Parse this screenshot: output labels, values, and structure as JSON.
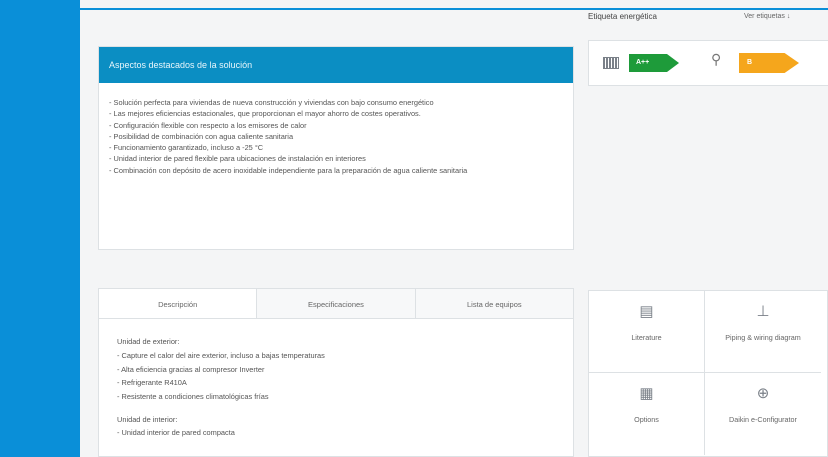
{
  "energy_label": {
    "title": "Etiqueta energética",
    "link": "Ver etiquetas",
    "link_icon": "↓",
    "heating_icon": "radiator-icon",
    "heating_class": "A++",
    "water_icon": "⚲",
    "water_class": "B",
    "colors": {
      "green": "#1e9b3a",
      "orange": "#f5a61c"
    }
  },
  "highlights": {
    "title": "Aspectos destacados de la solución",
    "items": [
      "- Solución perfecta para viviendas de nueva construcción y viviendas con bajo consumo energético",
      "- Las mejores eficiencias estacionales, que proporcionan el mayor ahorro de costes operativos.",
      "- Configuración flexible con respecto a los emisores de calor",
      "- Posibilidad de combinación con agua caliente sanitaria",
      "- Funcionamiento garantizado, incluso a -25 °C",
      "- Unidad interior de pared flexible para ubicaciones de instalación en interiores",
      "- Combinación con depósito de acero inoxidable independiente para la preparación de agua caliente sanitaria"
    ]
  },
  "tabs": {
    "items": [
      "Descripción",
      "Especificaciones",
      "Lista de equipos"
    ],
    "active": 0
  },
  "description": {
    "outdoor_heading": "Unidad de exterior:",
    "outdoor_items": [
      "- Capture el calor del aire exterior, incluso a bajas temperaturas",
      "- Alta eficiencia gracias al compresor Inverter",
      "- Refrigerante R410A",
      "- Resistente a condiciones climatológicas frías"
    ],
    "indoor_heading": "Unidad de interior:",
    "indoor_cut": "- Unidad interior de pared compacta"
  },
  "resources": [
    {
      "label": "Literature",
      "icon": "▤"
    },
    {
      "label": "Piping & wiring diagram",
      "icon": "⊥"
    },
    {
      "label": "Options",
      "icon": "▦"
    },
    {
      "label": "Daikin e-Configurator",
      "icon": "⊕"
    }
  ],
  "colors": {
    "accent": "#0a8fd8",
    "header": "#0b8ec3"
  }
}
